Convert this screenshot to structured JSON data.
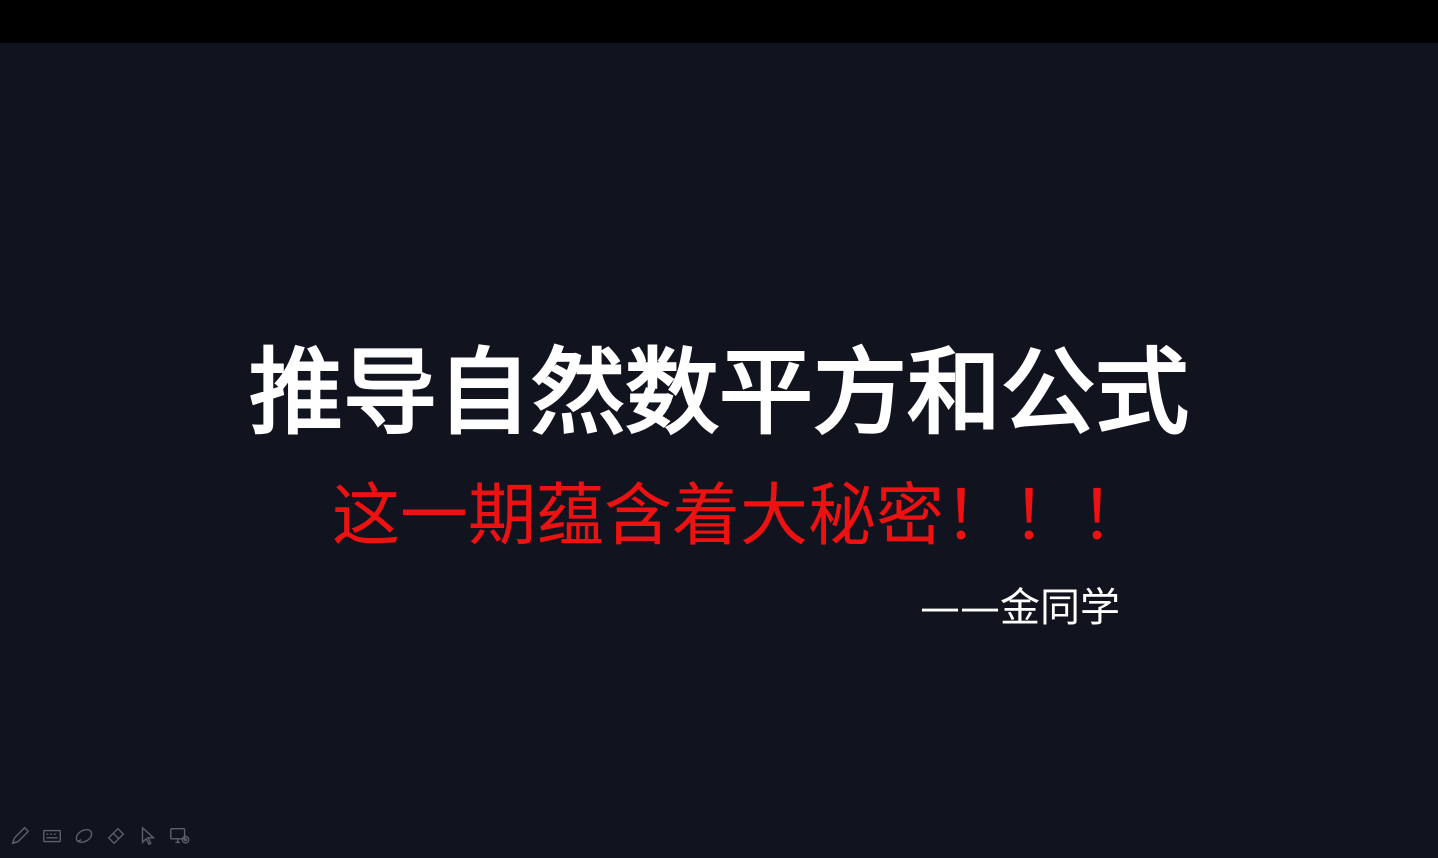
{
  "slide": {
    "title": "推导自然数平方和公式",
    "subtitle": "这一期蕴含着大秘密！！！",
    "author": "——金同学"
  },
  "colors": {
    "background": "#11131f",
    "letterbox": "#000000",
    "title": "#ffffff",
    "subtitle": "#ee1111",
    "author": "#ffffff"
  },
  "toolbar": {
    "icons": [
      "pen-icon",
      "keyboard-icon",
      "highlighter-icon",
      "eraser-icon",
      "pointer-icon",
      "screen-settings-icon"
    ]
  }
}
